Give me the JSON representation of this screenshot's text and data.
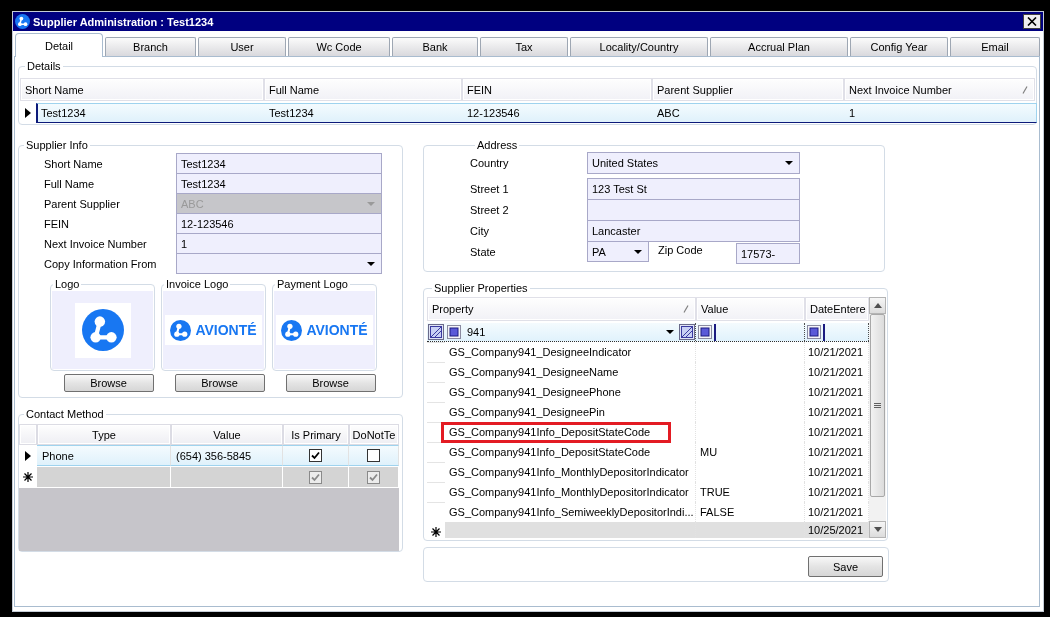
{
  "window": {
    "title": "Supplier Administration : Test1234"
  },
  "tabs": [
    {
      "label": "Detail",
      "selected": true
    },
    {
      "label": "Branch",
      "selected": false
    },
    {
      "label": "User",
      "selected": false
    },
    {
      "label": "Wc Code",
      "selected": false
    },
    {
      "label": "Bank",
      "selected": false
    },
    {
      "label": "Tax",
      "selected": false
    },
    {
      "label": "Locality/Country",
      "selected": false
    },
    {
      "label": "Accrual Plan",
      "selected": false
    },
    {
      "label": "Config Year",
      "selected": false
    },
    {
      "label": "Email",
      "selected": false
    }
  ],
  "details": {
    "title": "Details",
    "columns": [
      {
        "label": "Short Name",
        "sort_indicator": false
      },
      {
        "label": "Full Name",
        "sort_indicator": false
      },
      {
        "label": "FEIN",
        "sort_indicator": false
      },
      {
        "label": "Parent Supplier",
        "sort_indicator": false
      },
      {
        "label": "Next Invoice Number",
        "sort_indicator": true
      }
    ],
    "rows": [
      {
        "cells": [
          "Test1234",
          "Test1234",
          "12-123546",
          "ABC",
          "1"
        ],
        "selected": true
      }
    ]
  },
  "supplier_info": {
    "title": "Supplier Info",
    "fields": [
      {
        "label": "Short Name",
        "value": "Test1234",
        "kind": "text",
        "disabled": false
      },
      {
        "label": "Full Name",
        "value": "Test1234",
        "kind": "text",
        "disabled": false
      },
      {
        "label": "Parent Supplier",
        "value": "ABC",
        "kind": "dropdown",
        "disabled": true
      },
      {
        "label": "FEIN",
        "value": "12-123546",
        "kind": "text",
        "disabled": false
      },
      {
        "label": "Next Invoice Number",
        "value": "1",
        "kind": "text",
        "disabled": false
      },
      {
        "label": "Copy Information From",
        "kind": "dropdown",
        "disabled": false
      }
    ],
    "logos": [
      {
        "title": "Logo",
        "kind": "mark",
        "button": "Browse"
      },
      {
        "title": "Invoice Logo",
        "kind": "wordmark",
        "text": "AVIONTÉ",
        "button": "Browse"
      },
      {
        "title": "Payment Logo",
        "kind": "wordmark",
        "text": "AVIONTÉ",
        "button": "Browse"
      }
    ]
  },
  "contact_method": {
    "title": "Contact Method",
    "columns": [
      "Type",
      "Value",
      "Is Primary",
      "DoNotTe"
    ],
    "rows": [
      {
        "type": "Phone",
        "value": "(654) 356-5845",
        "is_primary": true,
        "column_4": false,
        "selected": true
      }
    ],
    "new_row": {
      "is_primary": true,
      "column_4": true
    }
  },
  "address": {
    "title": "Address",
    "fields": [
      {
        "label": "Country",
        "value": "United States",
        "kind": "dropdown"
      },
      {
        "label": "Street 1",
        "value": "123 Test St",
        "kind": "text"
      },
      {
        "label": "Street 2",
        "kind": "text"
      },
      {
        "label": "City",
        "value": "Lancaster",
        "kind": "text"
      }
    ],
    "state": {
      "label": "State",
      "value": "PA"
    },
    "zip": {
      "label": "Zip Code",
      "value": "17573-"
    }
  },
  "supplier_properties": {
    "title": "Supplier Properties",
    "columns": [
      {
        "label": "Property",
        "sort_indicator": true
      },
      {
        "label": "Value",
        "sort_indicator": false
      },
      {
        "label": "DateEntere",
        "sort_indicator": false
      }
    ],
    "filter": {
      "property": "941"
    },
    "rows": [
      {
        "property": "GS_Company941_DesigneeIndicator",
        "date": "10/21/2021",
        "highlighted": false
      },
      {
        "property": "GS_Company941_DesigneeName",
        "date": "10/21/2021",
        "highlighted": false
      },
      {
        "property": "GS_Company941_DesigneePhone",
        "date": "10/21/2021",
        "highlighted": false
      },
      {
        "property": "GS_Company941_DesigneePin",
        "date": "10/21/2021",
        "highlighted": false
      },
      {
        "property": "GS_Company941Info_DepositStateCode",
        "date": "10/21/2021",
        "highlighted": true
      },
      {
        "property": "GS_Company941Info_DepositStateCode",
        "value": "MU",
        "date": "10/21/2021",
        "highlighted": false
      },
      {
        "property": "GS_Company941Info_MonthlyDepositorIndicator",
        "date": "10/21/2021",
        "highlighted": false
      },
      {
        "property": "GS_Company941Info_MonthlyDepositorIndicator",
        "value": "TRUE",
        "date": "10/21/2021",
        "highlighted": false
      },
      {
        "property": "GS_Company941Info_SemiweeklyDepositorIndi...",
        "value": "FALSE",
        "date": "10/21/2021",
        "highlighted": false
      }
    ],
    "new_row": {
      "date": "10/25/2021"
    }
  },
  "save_button": "Save"
}
